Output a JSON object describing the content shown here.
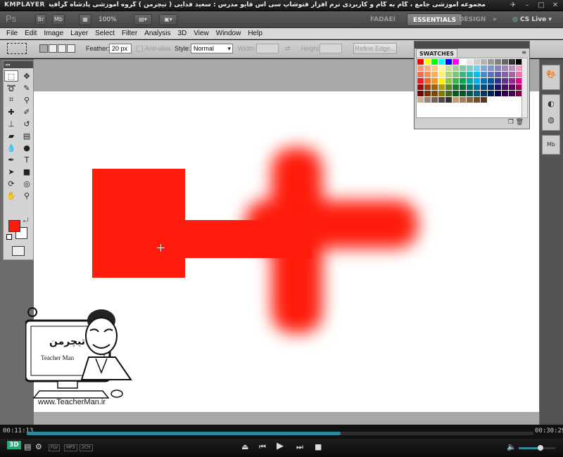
{
  "kmplayer": {
    "logo": "KMPLAYER",
    "video_title": "مجموعه آموزشی جامع ، گام به گام و کاربردی نرم افزار فتوشاپ سی اس فایو مدرس : سعید فدایی ( تیچرمن ) گروه آموزشی پادشاه گرافیست ها",
    "time_elapsed": "00:11:13",
    "time_total": "00:30:29",
    "progress_fraction": 0.62,
    "volume_fraction": 0.6,
    "badges": [
      "FLV",
      "MP3",
      "2CH"
    ]
  },
  "photoshop": {
    "logo": "Ps",
    "app_buttons": [
      "Br",
      "Mb"
    ],
    "zoom": "100%",
    "workspaces": [
      {
        "label": "FADAEI",
        "active": false
      },
      {
        "label": "ESSENTIALS",
        "active": true
      },
      {
        "label": "DESIGN",
        "active": false
      }
    ],
    "cs_live": "CS Live",
    "menus": [
      "File",
      "Edit",
      "Image",
      "Layer",
      "Select",
      "Filter",
      "Analysis",
      "3D",
      "View",
      "Window",
      "Help"
    ],
    "options": {
      "feather_label": "Feather:",
      "feather_value": "20 px",
      "antialias_label": "Anti-alias",
      "style_label": "Style:",
      "style_value": "Normal",
      "width_label": "Width:",
      "height_label": "Height:",
      "refine_button": "Refine Edge..."
    },
    "swatches_title": "SWATCHES",
    "foreground_color": "#ff1c0c",
    "background_color": "#ffffff",
    "canvas_art_color": "#ff1c0c"
  },
  "watermark": {
    "brand_fa": "تیچرمن",
    "brand_en": "Teacher Man",
    "url": "www.TeacherMan.ir"
  }
}
